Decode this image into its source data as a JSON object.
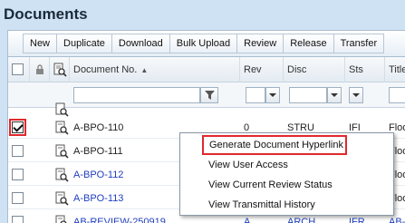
{
  "page": {
    "title": "Documents"
  },
  "toolbar": {
    "buttons": [
      "New",
      "Duplicate",
      "Download",
      "Bulk Upload",
      "Review",
      "Release",
      "Transfer"
    ]
  },
  "grid": {
    "columns": {
      "doc_no": "Document No.",
      "rev": "Rev",
      "disc": "Disc",
      "sts": "Sts",
      "title": "Title"
    },
    "sort_indicator": "▲",
    "rows": [
      {
        "doc_no": "A-BPO-110",
        "rev": "0",
        "disc": "STRU",
        "sts": "IFI",
        "title": "Floo",
        "checked": true,
        "link": false
      },
      {
        "doc_no": "A-BPO-111",
        "rev": "",
        "disc": "",
        "sts": "",
        "title": "Floo",
        "checked": false,
        "link": false
      },
      {
        "doc_no": "A-BPO-112",
        "rev": "",
        "disc": "",
        "sts": "",
        "title": "Floo",
        "checked": false,
        "link": true
      },
      {
        "doc_no": "A-BPO-113",
        "rev": "",
        "disc": "",
        "sts": "",
        "title": "Floo",
        "checked": false,
        "link": true
      },
      {
        "doc_no": "AB-REVIEW-250919",
        "rev": "A",
        "disc": "ARCH",
        "sts": "IFR",
        "title": "AB-R",
        "checked": false,
        "link": true
      }
    ]
  },
  "context_menu": {
    "items": [
      "Generate Document Hyperlink",
      "View User Access",
      "View Current Review Status",
      "View Transmittal History"
    ]
  },
  "colors": {
    "accent_red": "#e0282e",
    "link_blue": "#1f3fbf",
    "background": "#cfe2f3"
  },
  "icons": [
    "lock-icon",
    "document-search-icon",
    "filter-icon",
    "dropdown-arrow-icon",
    "checkbox-checked-icon"
  ]
}
